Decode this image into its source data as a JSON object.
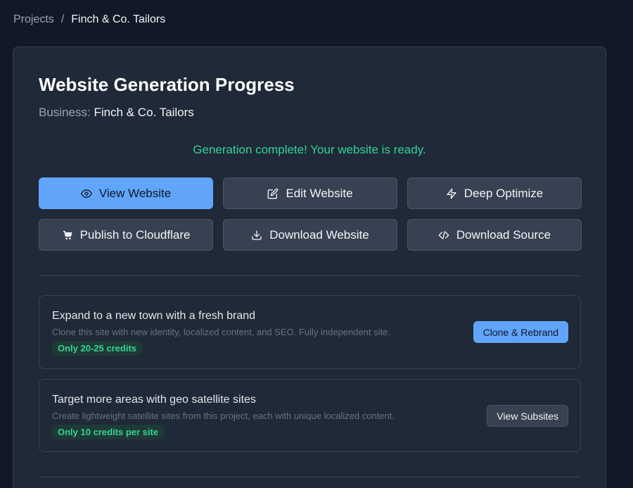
{
  "breadcrumb": {
    "parent": "Projects",
    "separator": "/",
    "current": "Finch & Co. Tailors"
  },
  "card": {
    "title": "Website Generation Progress",
    "business_label": "Business:",
    "business_name": "Finch & Co. Tailors",
    "status": "Generation complete! Your website is ready."
  },
  "actions": [
    {
      "label": "View Website",
      "icon": "eye-icon"
    },
    {
      "label": "Edit Website",
      "icon": "edit-icon"
    },
    {
      "label": "Deep Optimize",
      "icon": "lightning-icon"
    },
    {
      "label": "Publish to Cloudflare",
      "icon": "cart-icon"
    },
    {
      "label": "Download Website",
      "icon": "download-icon"
    },
    {
      "label": "Download Source",
      "icon": "code-icon"
    }
  ],
  "upsells": [
    {
      "title": "Expand to a new town with a fresh brand",
      "description": "Clone this site with new identity, localized content, and SEO. Fully independent site.",
      "badge": "Only 20-25 credits",
      "button": "Clone & Rebrand"
    },
    {
      "title": "Target more areas with geo satellite sites",
      "description": "Create lightweight satellite sites from this project, each with unique localized content.",
      "badge": "Only 10 credits per site",
      "button": "View Subsites"
    }
  ],
  "colors": {
    "background": "#111827",
    "card": "#1f2937",
    "primary": "#60a5fa",
    "success": "#34d399"
  }
}
